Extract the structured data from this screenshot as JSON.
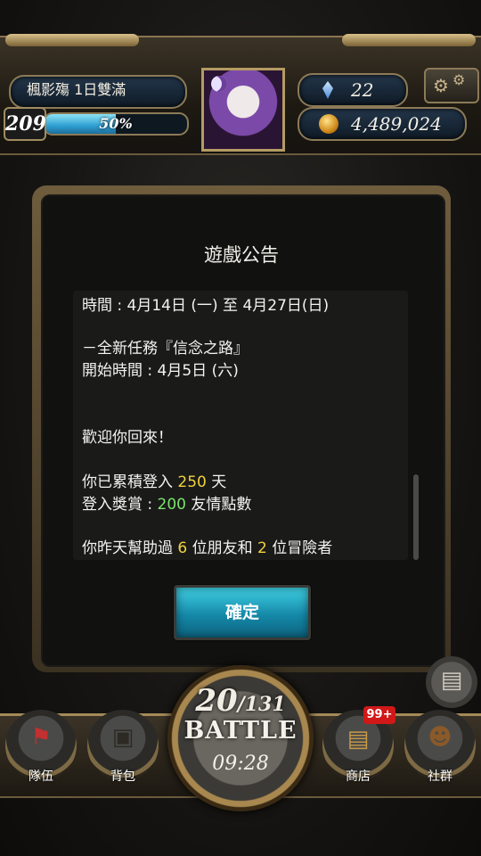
{
  "header": {
    "event_title": "楓影殤 1日雙滿",
    "level": "209",
    "exp_percent_text": "50%",
    "exp_fraction": 0.5,
    "gems": "22",
    "coins": "4,489,024"
  },
  "announcement": {
    "title": "遊戲公告",
    "lines": [
      {
        "text": "時間 : 4月14日 (一) 至 4月27日(日)"
      },
      {
        "text": "－全新任務『信念之路』"
      },
      {
        "text": "開始時間 : 4月5日 (六)"
      },
      {
        "text": "歡迎你回來！"
      },
      {
        "pre": "你已累積登入 ",
        "hl": "250",
        "post": " 天"
      },
      {
        "pre": "登入獎賞 : ",
        "hl": "200",
        "post": " 友情點數"
      },
      {
        "pre": "你昨天幫助過 ",
        "hl": "6",
        "mid": " 位朋友和 ",
        "hl2": "2",
        "post": " 位冒險者"
      }
    ],
    "confirm_label": "確定"
  },
  "battle": {
    "current": "20",
    "max": "/131",
    "label": "BATTLE",
    "timer": "09:28"
  },
  "nav": {
    "team": "隊伍",
    "bag": "背包",
    "shop": "商店",
    "shop_badge": "99+",
    "social": "社群"
  },
  "icons": {
    "gear": "gear-icon",
    "gem": "gem-icon",
    "coin": "coin-icon",
    "flag": "flag-icon",
    "backpack": "backpack-icon",
    "chest": "chest-icon",
    "people": "people-icon",
    "scroll": "scroll-icon"
  },
  "colors": {
    "highlight_yellow": "#f0d23c",
    "highlight_green": "#7be36a",
    "accent_cyan": "#2fb6d4"
  }
}
